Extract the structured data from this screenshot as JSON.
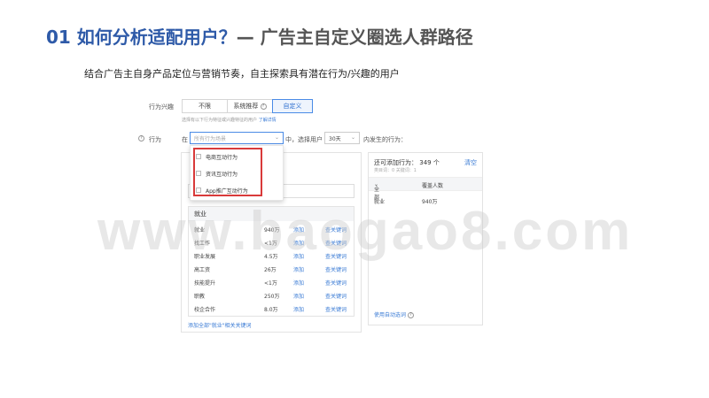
{
  "header": {
    "title_main": "01 如何分析适配用户？",
    "title_sub": "— 广告主自定义圈选人群路径",
    "subtitle": "结合广告主自身产品定位与营销节奏，自主探索具有潜在行为/兴趣的用户"
  },
  "form": {
    "interest_label": "行为兴趣",
    "segments": [
      "不限",
      "系统推荐",
      "自定义"
    ],
    "selected_segment": "自定义",
    "hint_text": "选择有以下行为特征或兴趣特征的用户",
    "hint_link": "了解详情",
    "behavior_label": "行为",
    "in_label": "在",
    "scene_placeholder": "所有行为场景",
    "middle_text": "中，选择用户",
    "days_value": "30天",
    "tail_text": "内发生的行为："
  },
  "dropdown": {
    "items": [
      "电商互动行为",
      "资讯互动行为",
      "App推广互动行为"
    ]
  },
  "left_panel": {
    "group_title": "就业",
    "rows": [
      {
        "name": "就业",
        "count": "940万",
        "add": "添加",
        "link": "查关键词"
      },
      {
        "name": "找工作",
        "count": "<1万",
        "add": "添加",
        "link": "查关键词"
      },
      {
        "name": "职业发展",
        "count": "4.5万",
        "add": "添加",
        "link": "查关键词"
      },
      {
        "name": "高工资",
        "count": "26万",
        "add": "添加",
        "link": "查关键词"
      },
      {
        "name": "技能提升",
        "count": "<1万",
        "add": "添加",
        "link": "查关键词"
      },
      {
        "name": "职教",
        "count": "250万",
        "add": "添加",
        "link": "查关键词"
      },
      {
        "name": "校企合作",
        "count": "8.0万",
        "add": "添加",
        "link": "查关键词"
      }
    ],
    "add_all": "添加全部\"就业\"相关关键词"
  },
  "right_panel": {
    "title": "还可添加行为：",
    "count": "349 个",
    "clear": "清空",
    "sub": "类目词：0    关键词：1",
    "col1": "全部",
    "col2": "覆盖人数",
    "rows": [
      {
        "name": "就业",
        "count": "940万"
      }
    ],
    "footer": "使用自动选词"
  },
  "watermark": "www.baogao8.com"
}
